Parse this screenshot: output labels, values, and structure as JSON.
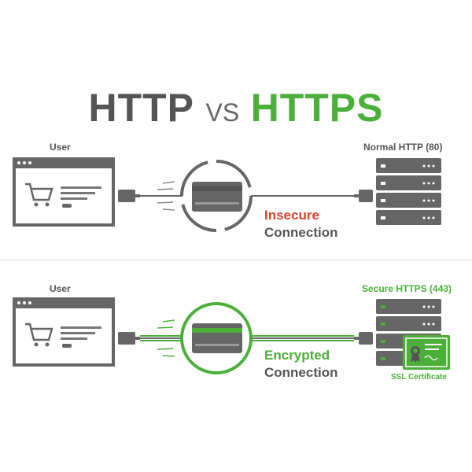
{
  "title": {
    "left": "HTTP",
    "vs": "VS",
    "right": "HTTPS"
  },
  "top_row": {
    "user_label": "User",
    "server_label": "Normal HTTP (80)",
    "status_word": "Insecure",
    "status_sub": "Connection"
  },
  "bottom_row": {
    "user_label": "User",
    "server_label": "Secure HTTPS (443)",
    "status_word": "Encrypted",
    "status_sub": "Connection",
    "cert_label": "SSL Certificate"
  },
  "colors": {
    "gray": "#666666",
    "dark": "#555555",
    "green": "#4caf3a",
    "red": "#d9412e"
  }
}
